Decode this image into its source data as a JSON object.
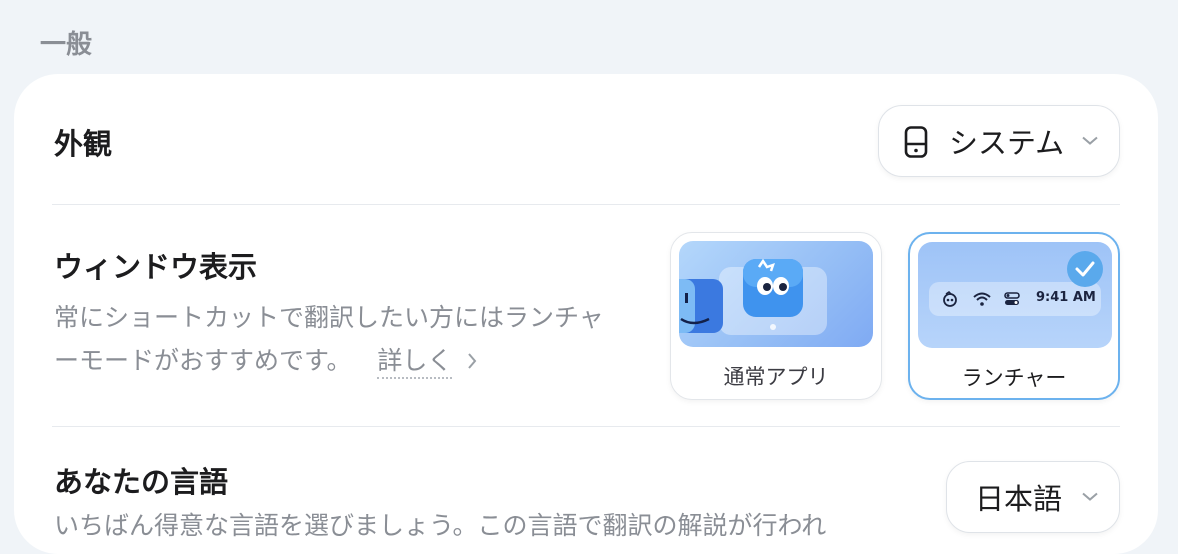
{
  "section": {
    "title": "一般"
  },
  "appearance": {
    "label": "外観",
    "value": "システム",
    "icon": "phone-icon"
  },
  "window_display": {
    "label": "ウィンドウ表示",
    "description": "常にショートカットで翻訳したい方にはランチャーモードがおすすめです。",
    "more_link": "詳しく",
    "options": [
      {
        "label": "通常アプリ",
        "selected": false
      },
      {
        "label": "ランチャー",
        "selected": true,
        "time": "9:41 AM"
      }
    ]
  },
  "language": {
    "label": "あなたの言語",
    "value": "日本語",
    "description": "いちばん得意な言語を選びましょう。この言語で翻訳の解説が行われ"
  },
  "colors": {
    "accent": "#6cb2ee",
    "check": "#5aa9ec"
  }
}
